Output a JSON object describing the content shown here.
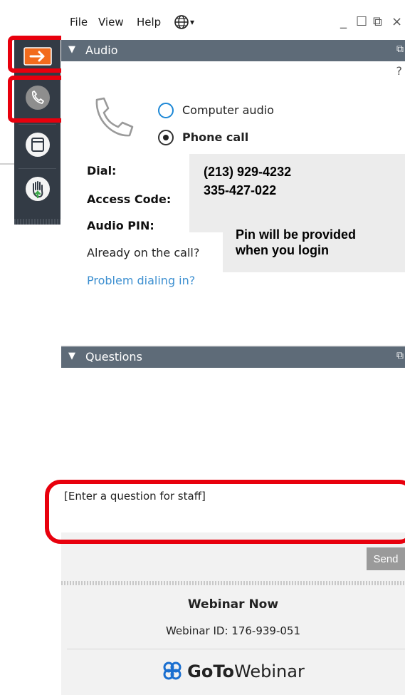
{
  "menu": {
    "file": "File",
    "view": "View",
    "help": "Help",
    "globe_icon": "globe-icon",
    "dropdown_glyph": "▾"
  },
  "window_controls": {
    "minimize": "_",
    "maximize": "☐",
    "restore": "⧉",
    "close": "×"
  },
  "toolbar": {
    "items": [
      {
        "icon": "arrow-right-icon",
        "color": "#f26b1d"
      },
      {
        "icon": "phone-icon"
      },
      {
        "icon": "window-icon"
      },
      {
        "icon": "raise-hand-icon"
      }
    ],
    "highlight_color": "#e8000d"
  },
  "audio": {
    "header": "Audio",
    "help": "?",
    "options": [
      {
        "label": "Computer audio",
        "selected": false
      },
      {
        "label": "Phone call",
        "selected": true
      }
    ],
    "dial_label": "Dial:",
    "access_label": "Access Code:",
    "pin_label": "Audio PIN:",
    "already_label": "Already on the call?",
    "problem_link": "Problem dialing in?",
    "callout_number": "(213) 929-4232",
    "callout_code": "335-427-022",
    "callout_pin_line1": "Pin will be provided",
    "callout_pin_line2": "when you login"
  },
  "questions": {
    "header": "Questions",
    "input_placeholder": "[Enter a question for staff]",
    "send_label": "Send"
  },
  "footer": {
    "title": "Webinar Now",
    "webinar_id": "Webinar ID: 176-939-051",
    "brand_bold": "GoTo",
    "brand_light": "Webinar"
  },
  "colors": {
    "header_bg": "#5e6b78",
    "toolbar_bg": "#333b45",
    "link": "#3c8fd0",
    "radio_ring": "#1e88d6"
  }
}
